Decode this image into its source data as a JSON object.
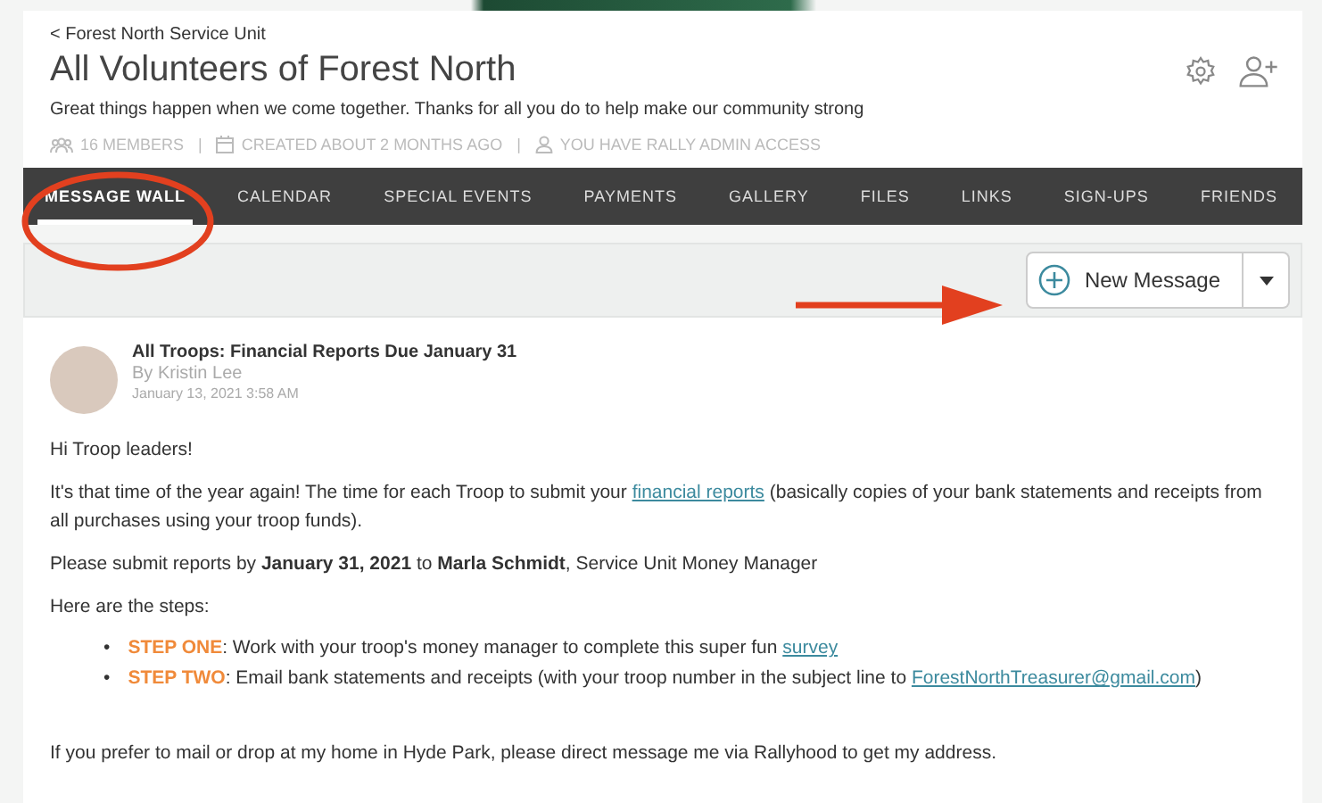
{
  "header": {
    "back_link": "< Forest North Service Unit",
    "title": "All Volunteers of Forest North",
    "tagline": "Great things happen when we come together. Thanks for all you do to help make our community strong",
    "meta": [
      {
        "kind": "members",
        "text": "16 MEMBERS"
      },
      {
        "kind": "created",
        "text": "CREATED ABOUT 2 MONTHS AGO"
      },
      {
        "kind": "admin",
        "text": "YOU HAVE RALLY ADMIN ACCESS"
      }
    ],
    "separators": [
      "|",
      "|"
    ]
  },
  "tabs": [
    {
      "label": "MESSAGE WALL",
      "selected": true
    },
    {
      "label": "CALENDAR",
      "selected": false
    },
    {
      "label": "SPECIAL EVENTS",
      "selected": false
    },
    {
      "label": "PAYMENTS",
      "selected": false
    },
    {
      "label": "GALLERY",
      "selected": false
    },
    {
      "label": "FILES",
      "selected": false
    },
    {
      "label": "LINKS",
      "selected": false
    },
    {
      "label": "SIGN-UPS",
      "selected": false
    },
    {
      "label": "FRIENDS",
      "selected": false
    }
  ],
  "toolbar": {
    "new_message": "New Message"
  },
  "message": {
    "title": "All Troops: Financial Reports Due January 31",
    "author": "By Kristin Lee",
    "date": "January 13, 2021 3:58 AM",
    "paragraphs": [
      {
        "kind": "para",
        "segments": [
          {
            "kind": "text",
            "text": "Hi Troop leaders!"
          }
        ]
      },
      {
        "kind": "para",
        "segments": [
          {
            "kind": "text",
            "text": "It's that time of the year again! The time for each Troop to submit your "
          },
          {
            "kind": "link",
            "text": "financial reports"
          },
          {
            "kind": "text",
            "text": " (basically copies of your bank statements and receipts from all purchases using your troop funds)."
          }
        ]
      },
      {
        "kind": "para",
        "segments": [
          {
            "kind": "text",
            "text": "Please submit reports by **January 31, 2021** to **Marla Schmidt**, Service Unit Money Manager"
          }
        ]
      },
      {
        "kind": "para",
        "segments": [
          {
            "kind": "text",
            "text": "Here are the steps:"
          }
        ]
      },
      {
        "kind": "list",
        "items": [
          {
            "bullet": "•",
            "segments": [
              {
                "kind": "step",
                "text": "STEP ONE"
              },
              {
                "kind": "text",
                "text": ": Work with your troop's money manager to complete this super fun "
              },
              {
                "kind": "link",
                "text": "survey"
              }
            ]
          },
          {
            "bullet": "•",
            "segments": [
              {
                "kind": "step",
                "text": "STEP TWO"
              },
              {
                "kind": "text",
                "text": ": Email bank statements and receipts (with your troop number in the subject line to "
              },
              {
                "kind": "link",
                "text": "ForestNorthTreasurer@gmail.com"
              },
              {
                "kind": "text",
                "text": ")"
              }
            ]
          }
        ]
      },
      {
        "kind": "spacer"
      },
      {
        "kind": "para",
        "segments": [
          {
            "kind": "text",
            "text": "If you prefer to mail or drop at my home in Hyde Park, please direct message me via Rallyhood to get my address."
          }
        ]
      }
    ]
  }
}
